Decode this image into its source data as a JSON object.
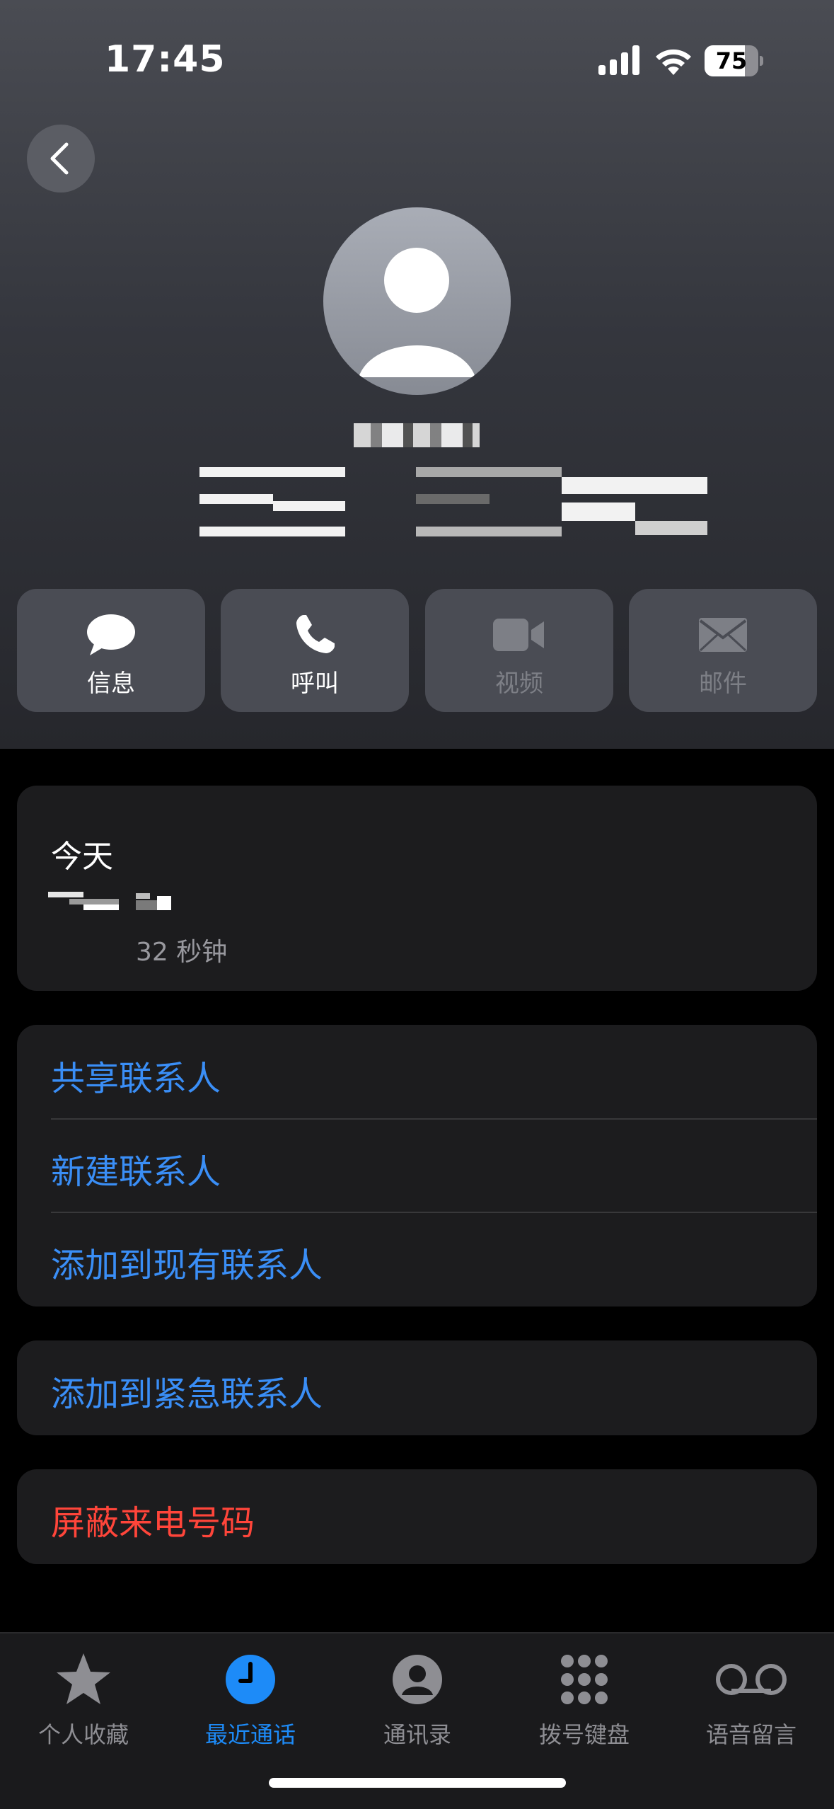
{
  "status_bar": {
    "time": "17:45",
    "battery_level": "75",
    "battery_fraction": 0.75
  },
  "actions": [
    {
      "label": "信息",
      "icon": "message-icon",
      "enabled": true
    },
    {
      "label": "呼叫",
      "icon": "phone-icon",
      "enabled": true
    },
    {
      "label": "视频",
      "icon": "video-icon",
      "enabled": false
    },
    {
      "label": "邮件",
      "icon": "mail-icon",
      "enabled": false
    }
  ],
  "call_history": {
    "day": "今天",
    "duration": "32 秒钟"
  },
  "contact_options": [
    "共享联系人",
    "新建联系人",
    "添加到现有联系人"
  ],
  "emergency_option": "添加到紧急联系人",
  "block_option": "屏蔽来电号码",
  "tabbar": {
    "active": "最近通话",
    "tabs": [
      {
        "label": "个人收藏",
        "icon": "star-icon"
      },
      {
        "label": "最近通话",
        "icon": "clock-icon"
      },
      {
        "label": "通讯录",
        "icon": "contacts-icon"
      },
      {
        "label": "拨号键盘",
        "icon": "keypad-icon"
      },
      {
        "label": "语音留言",
        "icon": "voicemail-icon"
      }
    ]
  },
  "colors": {
    "link_blue": "#3a8ef6",
    "destructive_red": "#ff453a",
    "active_tab": "#1d8bf8"
  }
}
